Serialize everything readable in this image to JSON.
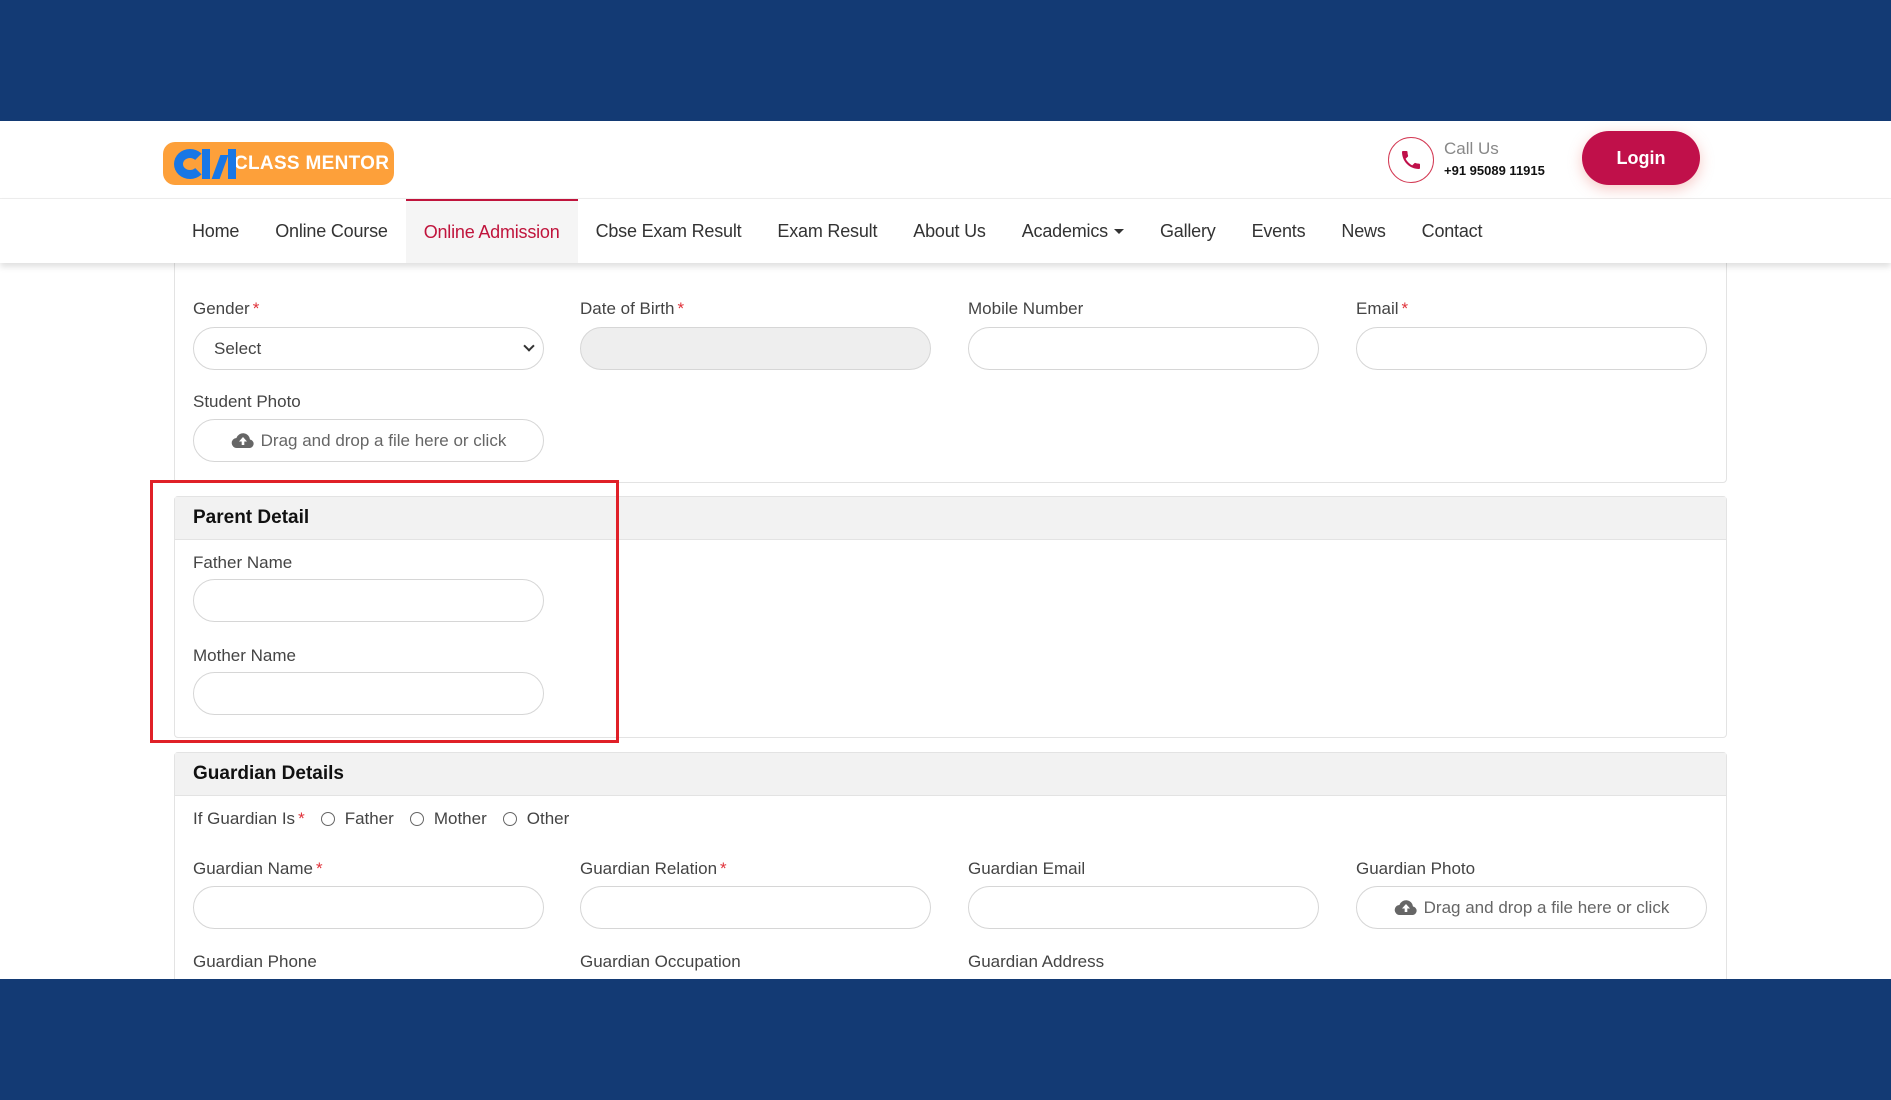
{
  "header": {
    "logo_text": "CLASS MENTOR",
    "call_label": "Call Us",
    "call_number": "+91 95089 11915",
    "login_label": "Login"
  },
  "nav": {
    "items": [
      {
        "label": "Home"
      },
      {
        "label": "Online Course"
      },
      {
        "label": "Online Admission",
        "active": true
      },
      {
        "label": "Cbse Exam Result"
      },
      {
        "label": "Exam Result"
      },
      {
        "label": "About Us"
      },
      {
        "label": "Academics",
        "dropdown": true
      },
      {
        "label": "Gallery"
      },
      {
        "label": "Events"
      },
      {
        "label": "News"
      },
      {
        "label": "Contact"
      }
    ]
  },
  "student": {
    "gender_label": "Gender",
    "gender_value": "Select",
    "dob_label": "Date of Birth",
    "mobile_label": "Mobile Number",
    "email_label": "Email",
    "photo_label": "Student Photo",
    "upload_text": "Drag and drop a file here or click",
    "required_mark": "*"
  },
  "parent": {
    "title": "Parent Detail",
    "father_label": "Father Name",
    "mother_label": "Mother Name"
  },
  "guardian": {
    "title": "Guardian Details",
    "if_label": "If Guardian Is",
    "options": [
      "Father",
      "Mother",
      "Other"
    ],
    "name_label": "Guardian Name",
    "relation_label": "Guardian Relation",
    "email_label": "Guardian Email",
    "photo_label": "Guardian Photo",
    "upload_text": "Drag and drop a file here or click",
    "phone_label": "Guardian Phone",
    "occupation_label": "Guardian Occupation",
    "address_label": "Guardian Address"
  },
  "colors": {
    "band": "#133a74",
    "accent": "#c0104a",
    "logo_bg": "#fda03a",
    "logo_mark": "#1877e6",
    "annotation": "#e02028"
  }
}
